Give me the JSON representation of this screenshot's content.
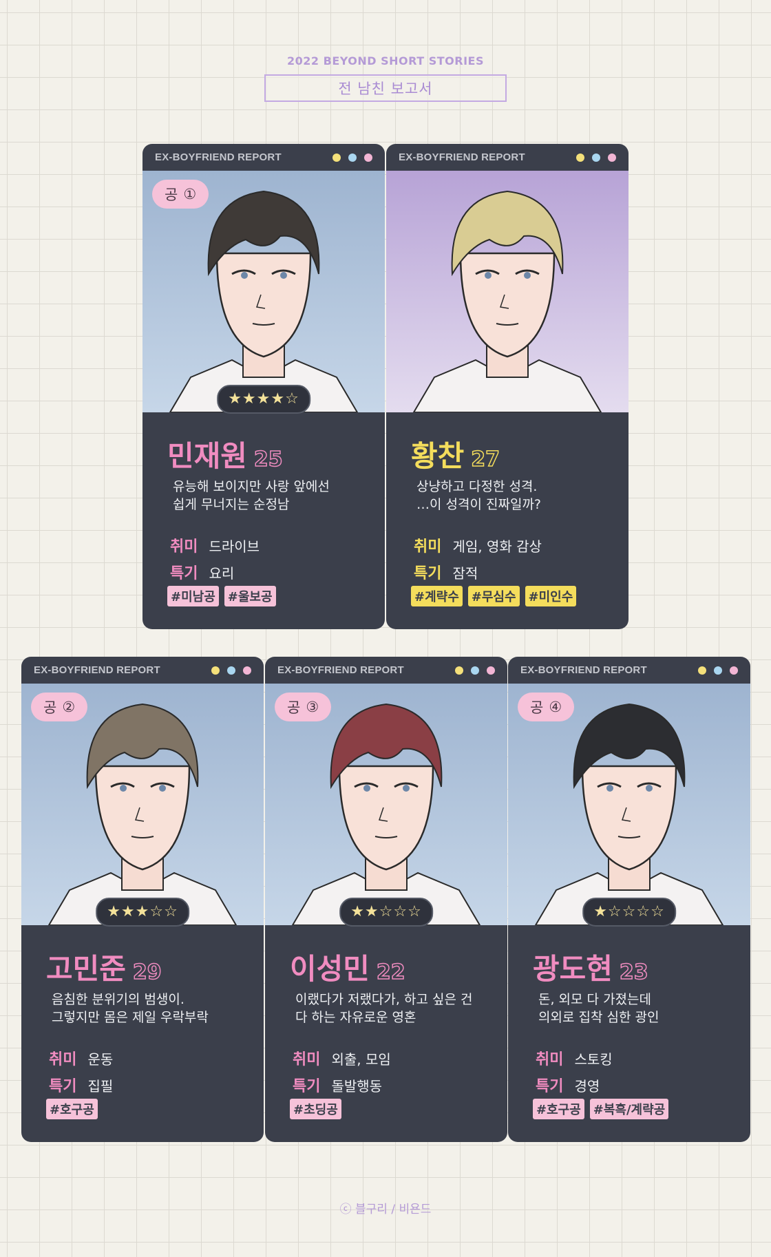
{
  "header": {
    "eyebrow": "2022 BEYOND SHORT STORIES",
    "title": "전 남친 보고서"
  },
  "colors": {
    "card_bg": "#3b3f4b",
    "pink": "#f08cc0",
    "yellow": "#f4dd5c",
    "tag_pink": "#f6c2d9",
    "tag_yellow": "#f4dd5c",
    "dot_yellow": "#f4e07a",
    "dot_blue": "#a9d6f0",
    "dot_pink": "#f2b5d4"
  },
  "cards": [
    {
      "brand": "EX-BOYFRIEND REPORT",
      "badge_role": "공",
      "badge_number": "①",
      "stars": "★★★★☆",
      "rating": 4,
      "name": "민재원",
      "age": "25",
      "desc_line1": "유능해 보이지만 사랑 앞에선",
      "desc_line2": "쉽게 무너지는 순정남",
      "hobby_label": "취미",
      "hobby": "드라이브",
      "skill_label": "특기",
      "skill": "요리",
      "tags": [
        "#미남공",
        "#울보공"
      ],
      "accent": "pink",
      "hair": "dark-brown",
      "background": "blue"
    },
    {
      "brand": "EX-BOYFRIEND REPORT",
      "name": "황찬",
      "age": "27",
      "desc_line1": "상냥하고 다정한 성격.",
      "desc_line2": "…이 성격이 진짜일까?",
      "hobby_label": "취미",
      "hobby": "게임, 영화 감상",
      "skill_label": "특기",
      "skill": "잠적",
      "tags": [
        "#계략수",
        "#무심수",
        "#미인수"
      ],
      "accent": "yellow",
      "hair": "blonde",
      "background": "lavender"
    },
    {
      "brand": "EX-BOYFRIEND REPORT",
      "badge_role": "공",
      "badge_number": "②",
      "stars": "★★★☆☆",
      "rating": 3,
      "name": "고민준",
      "age": "29",
      "desc_line1": "음침한 분위기의 범생이.",
      "desc_line2": "그렇지만 몸은 제일 우락부락",
      "hobby_label": "취미",
      "hobby": "운동",
      "skill_label": "특기",
      "skill": "집필",
      "tags": [
        "#호구공"
      ],
      "accent": "pink",
      "hair": "ash-brown",
      "background": "blue"
    },
    {
      "brand": "EX-BOYFRIEND REPORT",
      "badge_role": "공",
      "badge_number": "③",
      "stars": "★★☆☆☆",
      "rating": 2,
      "name": "이성민",
      "age": "22",
      "desc_line1": "이랬다가 저랬다가, 하고 싶은 건",
      "desc_line2": "다 하는 자유로운 영혼",
      "hobby_label": "취미",
      "hobby": "외출, 모임",
      "skill_label": "특기",
      "skill": "돌발행동",
      "tags": [
        "#초딩공"
      ],
      "accent": "pink",
      "hair": "red-brown",
      "background": "blue"
    },
    {
      "brand": "EX-BOYFRIEND REPORT",
      "badge_role": "공",
      "badge_number": "④",
      "stars": "★☆☆☆☆",
      "rating": 1,
      "name": "광도현",
      "age": "23",
      "desc_line1": "돈, 외모 다 가졌는데",
      "desc_line2": "의외로 집착 심한 광인",
      "hobby_label": "취미",
      "hobby": "스토킹",
      "skill_label": "특기",
      "skill": "경영",
      "tags": [
        "#호구공",
        "#복흑/계략공"
      ],
      "accent": "pink",
      "hair": "black",
      "background": "blue"
    }
  ],
  "footer": "ⓒ 블구리 / 비욘드"
}
